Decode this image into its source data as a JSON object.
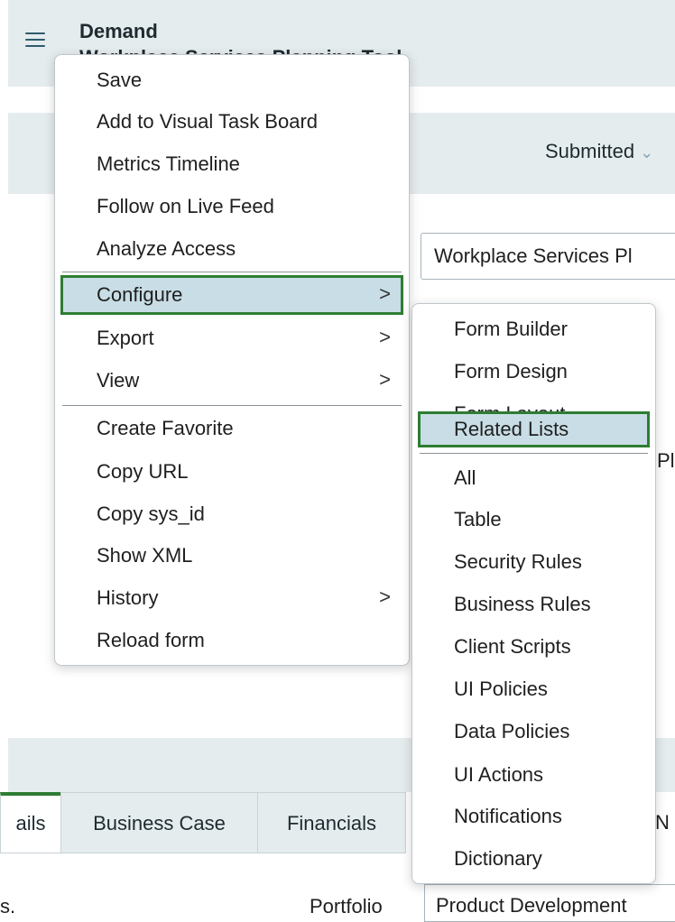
{
  "header": {
    "title_line1": "Demand",
    "title_line2": "Workplace Services Planning Tool",
    "state_value": "Submitted"
  },
  "form": {
    "field_value": "Workplace Services Pl",
    "stub_text": "Pl",
    "tab_n": "N",
    "portfolio_label": "Portfolio",
    "portfolio_value": "Product Development",
    "left_stub": "s."
  },
  "tabs": [
    "ails",
    "Business Case",
    "Financials"
  ],
  "context_menu": {
    "items": [
      {
        "label": "Save"
      },
      {
        "label": "Add to Visual Task Board"
      },
      {
        "label": "Metrics Timeline"
      },
      {
        "label": "Follow on Live Feed"
      },
      {
        "label": "Analyze Access"
      },
      {
        "label": "Configure",
        "submenu": true,
        "highlighted": true
      },
      {
        "label": "Export",
        "submenu": true
      },
      {
        "label": "View",
        "submenu": true
      },
      {
        "label": "Create Favorite"
      },
      {
        "label": "Copy URL"
      },
      {
        "label": "Copy sys_id"
      },
      {
        "label": "Show XML"
      },
      {
        "label": "History",
        "submenu": true
      },
      {
        "label": "Reload form"
      }
    ],
    "submenu_chevron": ">"
  },
  "configure_submenu": {
    "items": [
      {
        "label": "Form Builder"
      },
      {
        "label": "Form Design"
      },
      {
        "label": "Form Layout"
      },
      {
        "label": "Related Lists",
        "highlighted": true
      },
      {
        "label": "All"
      },
      {
        "label": "Table"
      },
      {
        "label": "Security Rules"
      },
      {
        "label": "Business Rules"
      },
      {
        "label": "Client Scripts"
      },
      {
        "label": "UI Policies"
      },
      {
        "label": "Data Policies"
      },
      {
        "label": "UI Actions"
      },
      {
        "label": "Notifications"
      },
      {
        "label": "Dictionary"
      }
    ]
  },
  "colors": {
    "highlight_bg": "#c8dde5",
    "highlight_border": "#2e7d32",
    "header_bg": "#e5ecee"
  },
  "icons": {
    "menu": "hamburger-icon",
    "submenu": "chevron-right-icon",
    "state": "chevron-down-icon"
  }
}
